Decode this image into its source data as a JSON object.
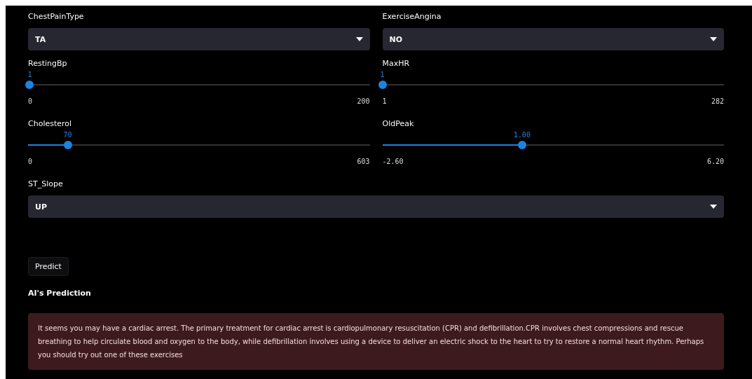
{
  "selects_top": [
    {
      "label": "ChestPainType",
      "value": "TA"
    },
    {
      "label": "ExerciseAngina",
      "value": "NO"
    }
  ],
  "sliders": [
    {
      "label": "RestingBp",
      "reading": "1",
      "min": "0",
      "max": "200",
      "level": 0.005
    },
    {
      "label": "MaxHR",
      "reading": "1",
      "min": "1",
      "max": "282",
      "level": 0
    },
    {
      "label": "Cholesterol",
      "reading": "70",
      "min": "0",
      "max": "603",
      "level": 0.116
    },
    {
      "label": "OldPeak",
      "reading": "1.00",
      "min": "-2.60",
      "max": "6.20",
      "level": 0.409
    }
  ],
  "select_bottom": {
    "label": "ST_Slope",
    "value": "UP"
  },
  "button": "Predict",
  "result": {
    "heading": "AI's Prediction",
    "message": "It seems you may have a cardiac arrest. The primary treatment for cardiac arrest is cardiopulmonary resuscitation (CPR) and defibrillation.CPR involves chest compressions and rescue breathing to help circulate blood and oxygen to the body, while defibrillation involves using a device to deliver an electric shock to the heart to try to restore a normal heart rhythm. Perhaps you should try out one of these exercises"
  }
}
